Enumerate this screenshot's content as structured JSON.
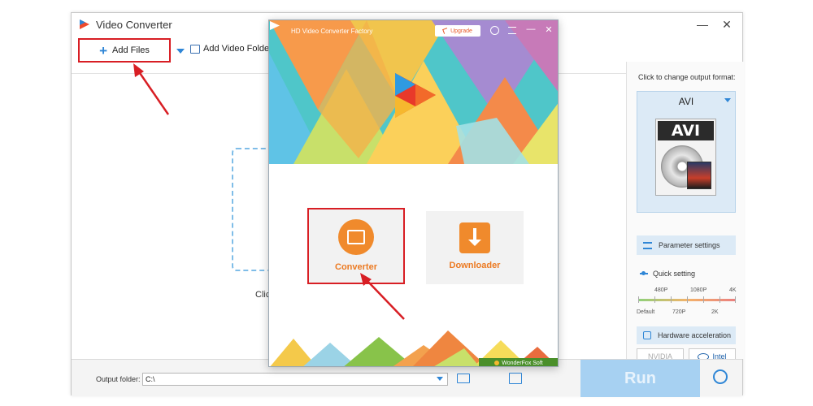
{
  "main_window": {
    "title": "Video Converter",
    "controls": {
      "minimize": "—",
      "close": "✕"
    },
    "toolbar": {
      "add_files_label": "Add Files",
      "add_video_folder_label": "Add Video Folder"
    },
    "drop_hint": "Click"
  },
  "right_panel": {
    "caption": "Click to change output format:",
    "format_name": "AVI",
    "format_badge": "AVI",
    "parameter_settings_label": "Parameter settings",
    "quick_setting_label": "Quick setting",
    "quick_top_ticks": [
      "480P",
      "1080P",
      "4K"
    ],
    "quick_bottom_ticks": [
      "Default",
      "720P",
      "2K"
    ],
    "hardware_acceleration_label": "Hardware acceleration",
    "gpu_options": {
      "nvidia": "NVIDIA",
      "intel": "Intel"
    }
  },
  "bottom_bar": {
    "output_folder_label": "Output folder:",
    "output_folder_value": "C:\\",
    "run_label": "Run"
  },
  "hd_window": {
    "title": "HD Video Converter Factory",
    "upgrade_label": "Upgrade",
    "controls": {
      "minimize": "—",
      "close": "✕"
    },
    "cards": {
      "converter": "Converter",
      "downloader": "Downloader"
    },
    "brand": "WonderFox Soft"
  },
  "colors": {
    "accent_blue": "#2f86d6",
    "highlight_red": "#d81e24",
    "card_orange": "#f08a2c",
    "run_button": "#a7d1f2"
  }
}
